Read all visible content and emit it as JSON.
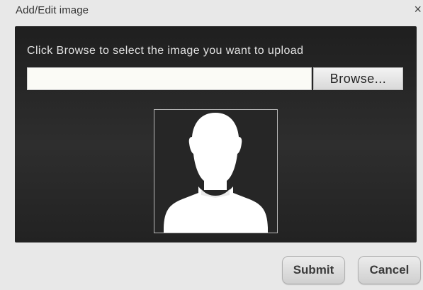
{
  "dialog": {
    "title": "Add/Edit image",
    "close_glyph": "×",
    "close_icon": "close-icon"
  },
  "upload": {
    "instructions": "Click Browse to select the image you want to upload",
    "file_value": "",
    "browse_label": "Browse..."
  },
  "preview": {
    "icon": "person-silhouette-icon"
  },
  "footer": {
    "submit_label": "Submit",
    "cancel_label": "Cancel"
  }
}
